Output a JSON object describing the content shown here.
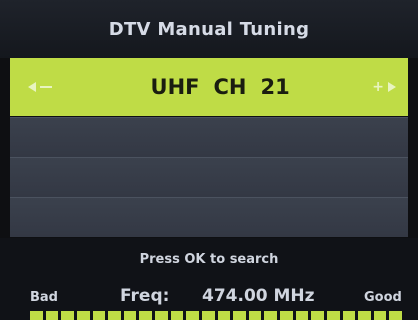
{
  "menu": {
    "title": "DTV Manual Tuning"
  },
  "channel": {
    "band": "UHF",
    "ch_label": "CH",
    "number": "21"
  },
  "search": {
    "hint": "Press OK to search"
  },
  "signal": {
    "bad_label": "Bad",
    "good_label": "Good",
    "freq_label": "Freq:",
    "freq_value": "474.00 MHz",
    "segments_lit": 24
  },
  "colors": {
    "accent": "#bfdc46"
  }
}
